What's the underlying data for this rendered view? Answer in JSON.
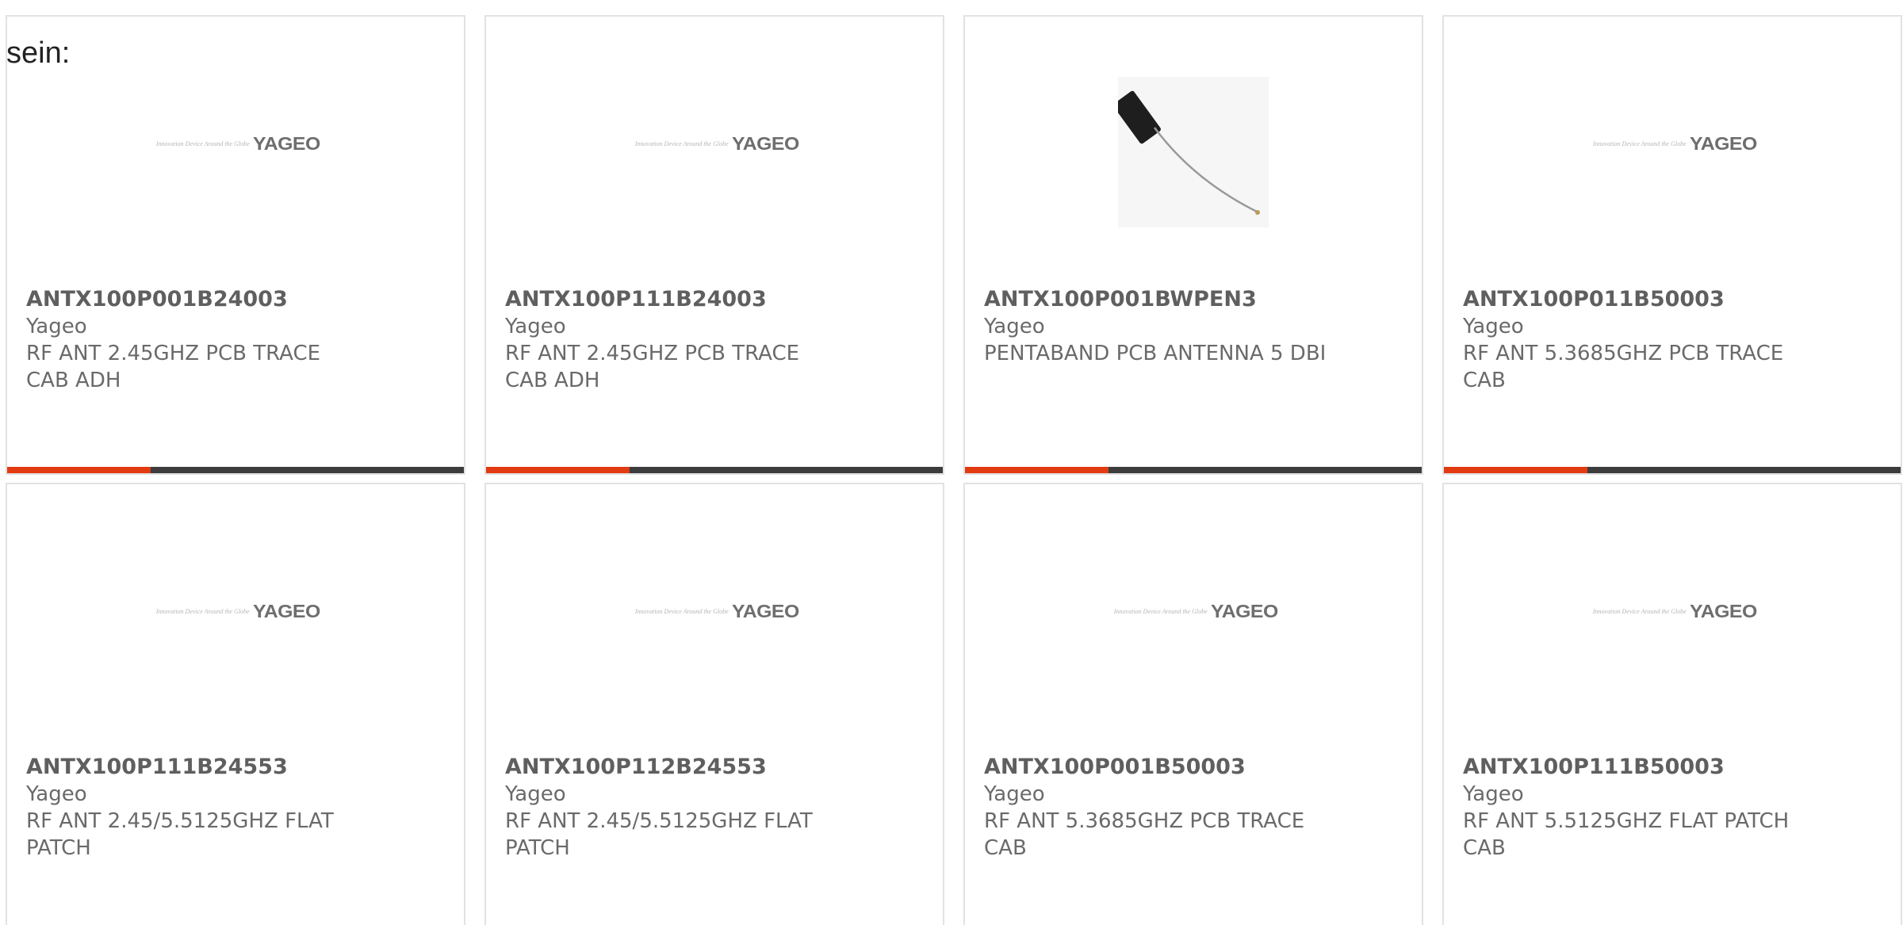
{
  "intro_text": "sein:",
  "brand": {
    "logo_word": "YAGEO",
    "logo_tagline": "Innovation Device Around the Globe",
    "accent_color": "#e23b12",
    "bar_color": "#3c3c3c"
  },
  "products": [
    {
      "part_number": "ANTX100P001B24003",
      "manufacturer": "Yageo",
      "description": "RF ANT 2.45GHZ PCB TRACE CAB ADH",
      "image": "yageo-logo",
      "show_bar": true
    },
    {
      "part_number": "ANTX100P111B24003",
      "manufacturer": "Yageo",
      "description": "RF ANT 2.45GHZ PCB TRACE CAB ADH",
      "image": "yageo-logo",
      "show_bar": true
    },
    {
      "part_number": "ANTX100P001BWPEN3",
      "manufacturer": "Yageo",
      "description": "PENTABAND PCB ANTENNA 5 DBI",
      "image": "antenna-photo",
      "show_bar": true
    },
    {
      "part_number": "ANTX100P011B50003",
      "manufacturer": "Yageo",
      "description": "RF ANT 5.3685GHZ PCB TRACE CAB",
      "image": "yageo-logo",
      "show_bar": true
    },
    {
      "part_number": "ANTX100P111B24553",
      "manufacturer": "Yageo",
      "description": "RF ANT 2.45/5.5125GHZ FLAT PATCH",
      "image": "yageo-logo",
      "show_bar": false
    },
    {
      "part_number": "ANTX100P112B24553",
      "manufacturer": "Yageo",
      "description": "RF ANT 2.45/5.5125GHZ FLAT PATCH",
      "image": "yageo-logo",
      "show_bar": false
    },
    {
      "part_number": "ANTX100P001B50003",
      "manufacturer": "Yageo",
      "description": "RF ANT 5.3685GHZ PCB TRACE CAB",
      "image": "yageo-logo",
      "show_bar": false
    },
    {
      "part_number": "ANTX100P111B50003",
      "manufacturer": "Yageo",
      "description": "RF ANT 5.5125GHZ FLAT PATCH CAB",
      "image": "yageo-logo",
      "show_bar": false
    }
  ]
}
